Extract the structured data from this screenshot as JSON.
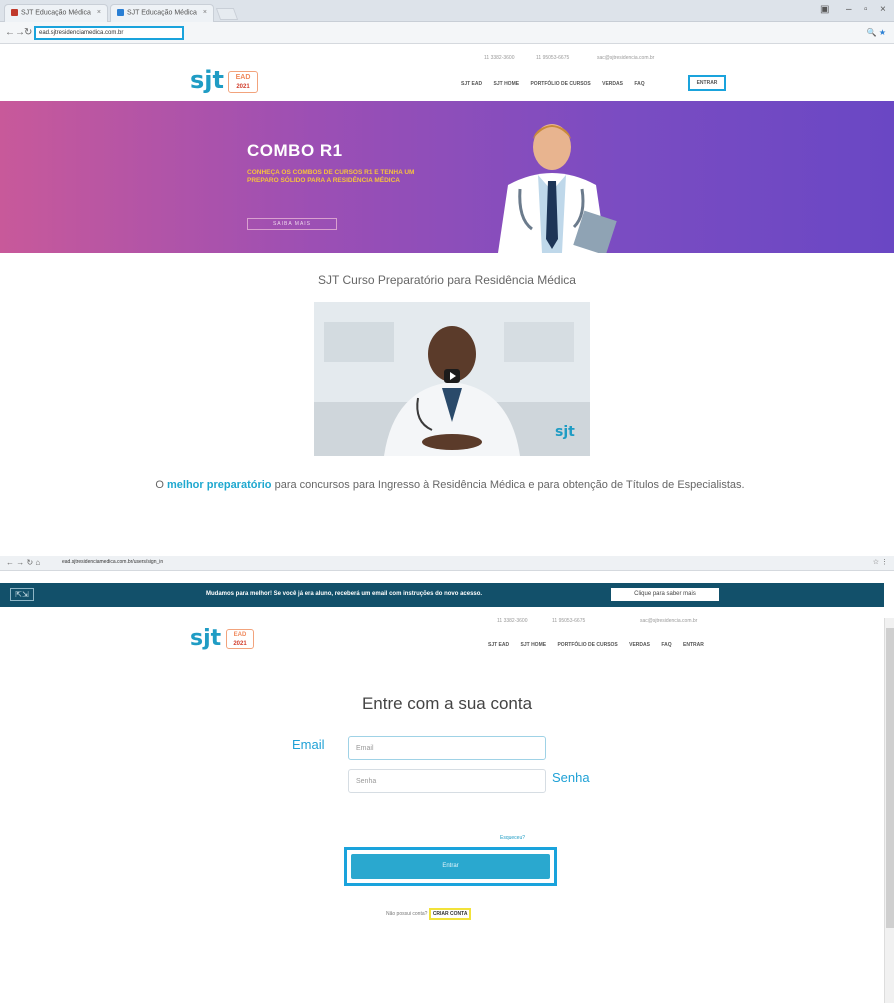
{
  "browser": {
    "tabs": [
      {
        "label": "SJT Educação Médica"
      },
      {
        "label": "SJT Educação Médica"
      }
    ],
    "url": "ead.sjtresidenciamedica.com.br",
    "url2": "ead.sjtresidenciamedica.com.br/users/sign_in"
  },
  "site": {
    "logo": "sjt",
    "badge_top": "EAD",
    "badge_bottom": "2021",
    "contact": {
      "phone1": "11 3382-3600",
      "phone2": "11 95053-6675",
      "email": "sac@sjtresidencia.com.br"
    },
    "nav": [
      "SJT EAD",
      "SJT HOME",
      "PORTFÓLIO DE CURSOS",
      "VERDAS",
      "FAQ"
    ],
    "nav_entrar": "ENTRAR"
  },
  "hero": {
    "title": "COMBO R1",
    "subtitle": "CONHEÇA OS COMBOS DE CURSOS R1 E TENHA UM PREPARO SÓLIDO PARA A RESIDÊNCIA MÉDICA",
    "button": "SAIBA MAIS"
  },
  "content": {
    "section_title": "SJT Curso Preparatório para Residência Médica",
    "video_logo": "sjt",
    "tagline_highlight": "melhor preparatório",
    "tagline_pre": "O ",
    "tagline_post": " para concursos para Ingresso à Residência Médica e para obtenção de Títulos de Especialistas."
  },
  "login_page": {
    "notice_text": "Mudamos para melhor! Se você já era aluno, receberá um email com instruções do novo acesso.",
    "notice_button": "Clique para saber mais",
    "nav": [
      "SJT EAD",
      "SJT HOME",
      "PORTFÓLIO DE CURSOS",
      "VERDAS",
      "FAQ",
      "ENTRAR"
    ],
    "title": "Entre com a sua conta",
    "email_placeholder": "Email",
    "password_placeholder": "Senha",
    "email_annotation": "Email",
    "password_annotation": "Senha",
    "forgot": "Esqueceu?",
    "submit": "Entrar",
    "signup_prompt": "Não possui conta?",
    "signup_link": "CRIAR CONTA"
  }
}
